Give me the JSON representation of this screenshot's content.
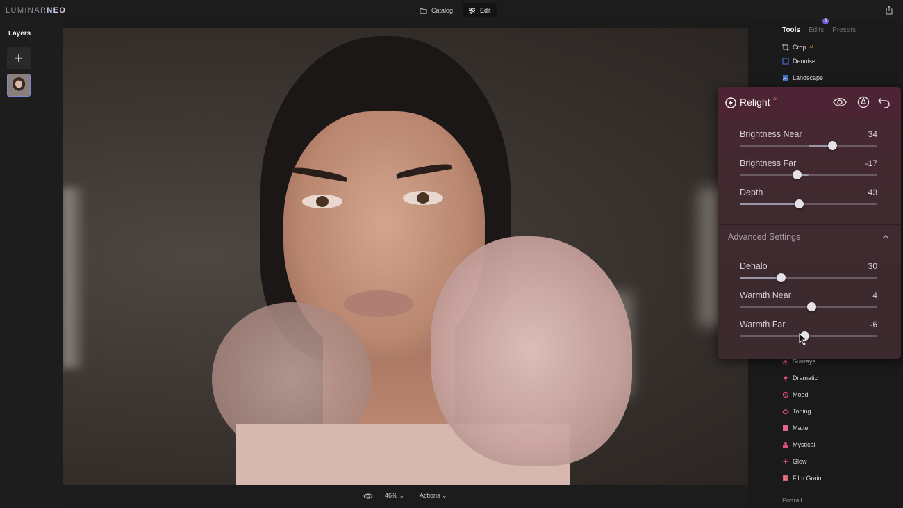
{
  "app": {
    "logo_text": "LUMINAR",
    "logo_accent": "NEO",
    "modes": [
      {
        "label": "Catalog",
        "icon": "folder-icon",
        "active": false
      },
      {
        "label": "Edit",
        "icon": "sliders-icon",
        "active": true
      }
    ],
    "share_icon": "share-icon"
  },
  "layers": {
    "title": "Layers",
    "add_icon": "plus-icon"
  },
  "bottom_bar": {
    "zoom_value": "46%",
    "zoom_chevron": "⌄",
    "actions_label": "Actions",
    "actions_chevron": "⌄"
  },
  "right_panel": {
    "tabs": [
      {
        "label": "Tools",
        "active": true
      },
      {
        "label": "Edits",
        "badge": "3"
      },
      {
        "label": "Presets"
      }
    ],
    "tools_top": [
      {
        "label": "Crop",
        "ai": "AI",
        "icon": "crop-icon"
      },
      {
        "label": "Denoise",
        "icon": "denoise-icon"
      },
      {
        "label": "Landscape",
        "icon": "landscape-icon"
      }
    ],
    "tools_bottom": [
      {
        "label": "Sunrays",
        "icon": "sunrays-icon"
      },
      {
        "label": "Dramatic",
        "icon": "dramatic-icon"
      },
      {
        "label": "Mood",
        "icon": "mood-icon"
      },
      {
        "label": "Toning",
        "icon": "toning-icon"
      },
      {
        "label": "Matte",
        "icon": "matte-icon"
      },
      {
        "label": "Mystical",
        "icon": "mystical-icon"
      },
      {
        "label": "Glow",
        "icon": "glow-icon"
      },
      {
        "label": "Film Grain",
        "icon": "film-grain-icon"
      }
    ],
    "section_portrait": "Portrait"
  },
  "relight": {
    "title": "Relight",
    "ai": "AI",
    "sliders": [
      {
        "label": "Brightness Near",
        "value": "34",
        "num": 34,
        "min": -100,
        "max": 100
      },
      {
        "label": "Brightness Far",
        "value": "-17",
        "num": -17,
        "min": -100,
        "max": 100
      },
      {
        "label": "Depth",
        "value": "43",
        "num": 43,
        "min": 0,
        "max": 100
      }
    ],
    "advanced_title": "Advanced Settings",
    "advanced_sliders": [
      {
        "label": "Dehalo",
        "value": "30",
        "num": 30,
        "min": 0,
        "max": 100
      },
      {
        "label": "Warmth Near",
        "value": "4",
        "num": 4,
        "min": -100,
        "max": 100
      },
      {
        "label": "Warmth Far",
        "value": "-6",
        "num": -6,
        "min": -100,
        "max": 100
      }
    ]
  },
  "colors": {
    "accent_badge": "#6b5fd6",
    "ai_orange": "#d58a55",
    "panel_bg": "#4d2434",
    "tool_icon_pink": "#e0507a",
    "tool_icon_blue": "#3f6fc7"
  }
}
